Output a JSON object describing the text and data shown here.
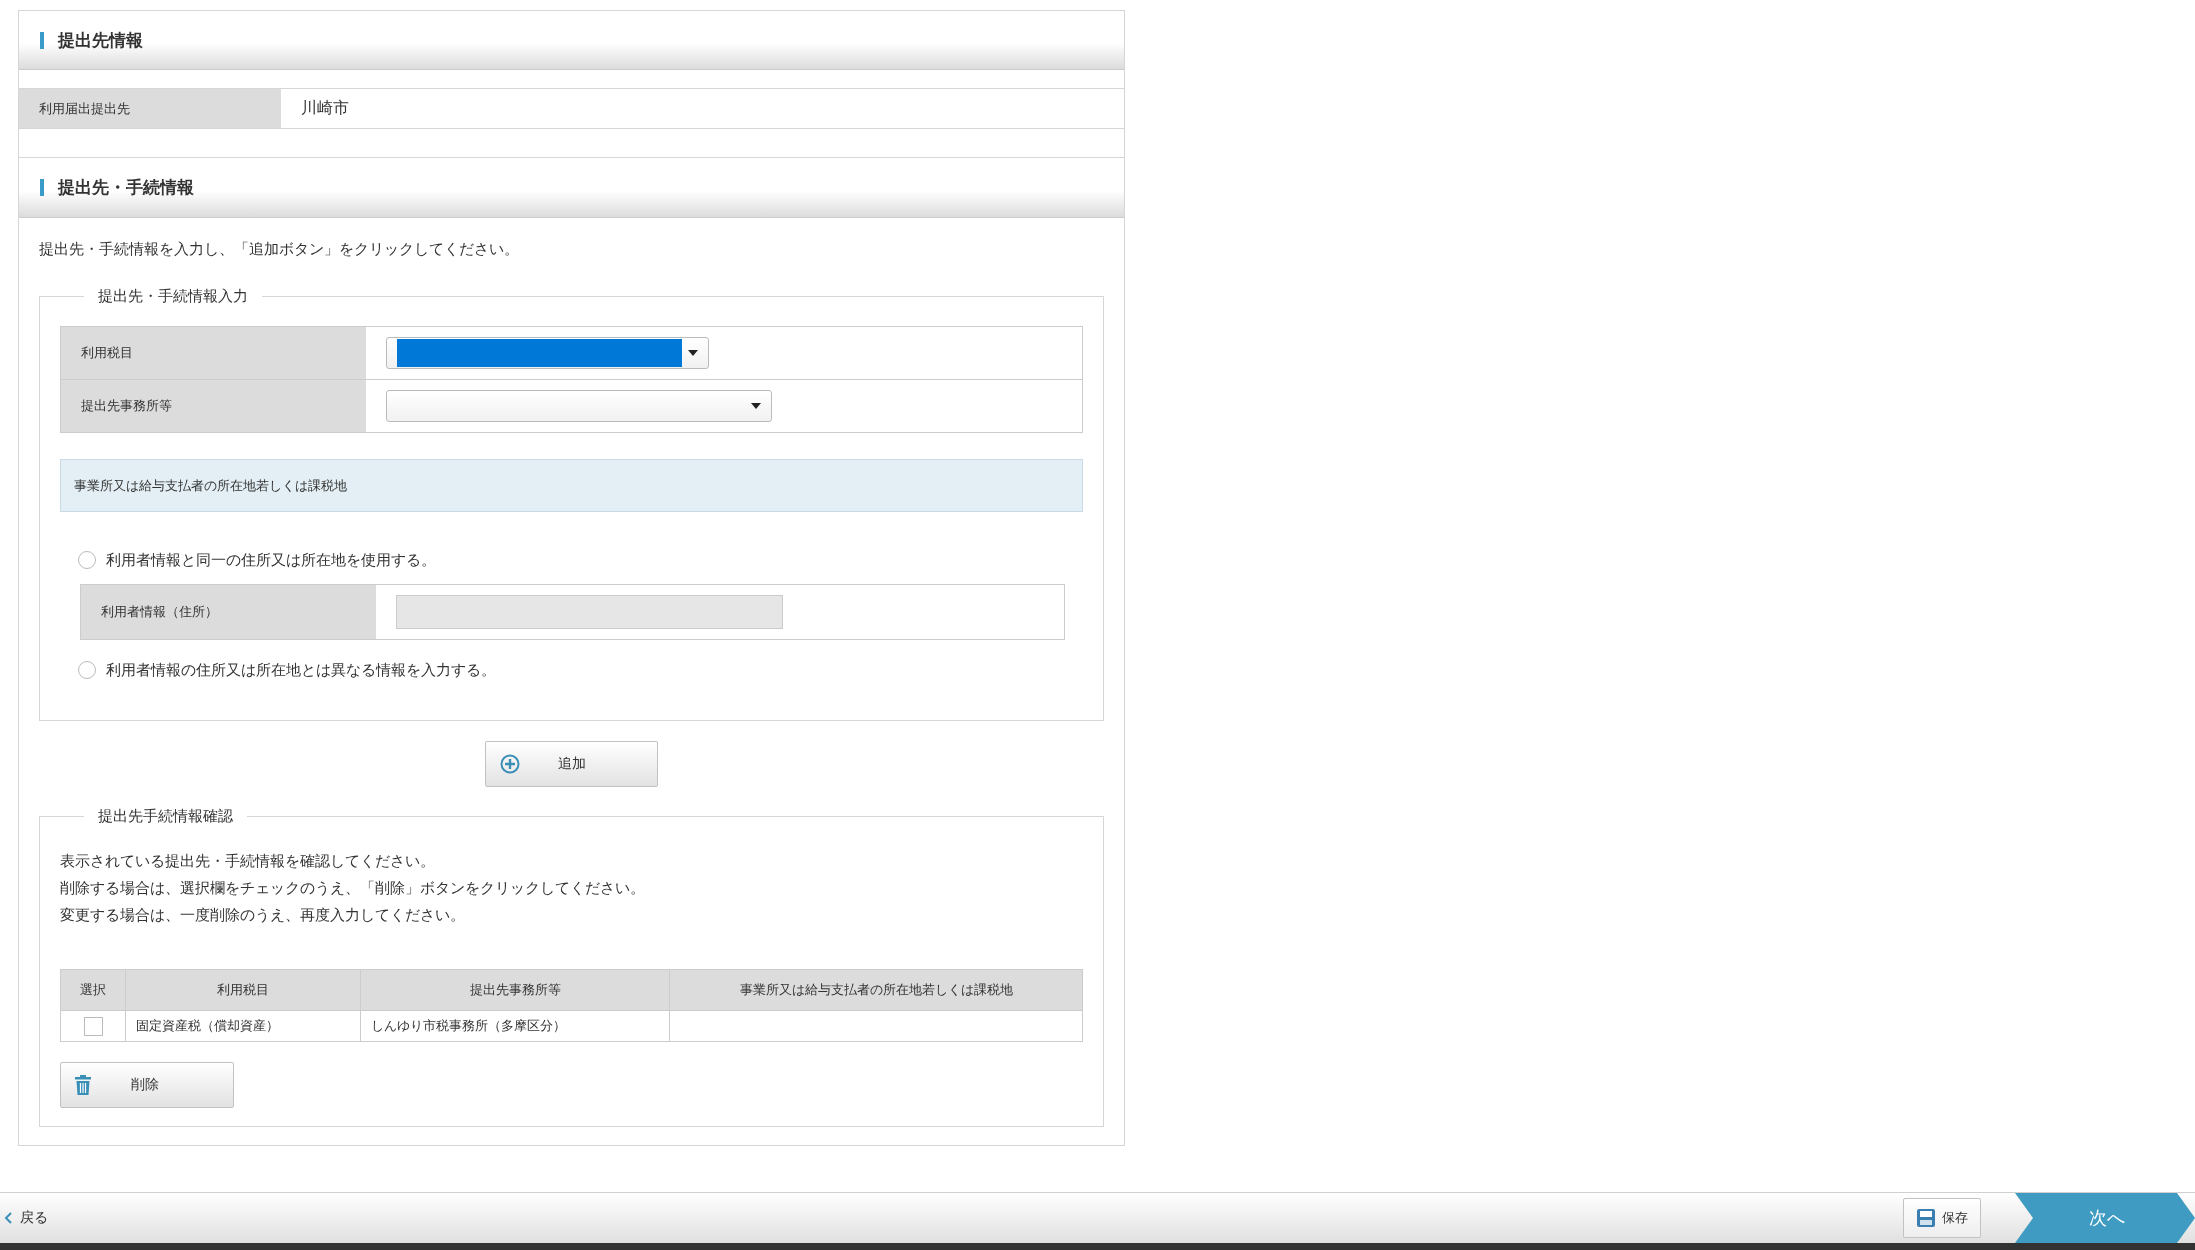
{
  "submission_info": {
    "title": "提出先情報",
    "rows": [
      {
        "label": "利用届出提出先",
        "value": "川崎市"
      }
    ]
  },
  "procedure_info": {
    "title": "提出先・手続情報",
    "instruction": "提出先・手続情報を入力し、「追加ボタン」をクリックしてください。",
    "input_group": {
      "legend": "提出先・手続情報入力",
      "fields": [
        {
          "label": "利用税目",
          "highlighted": true
        },
        {
          "label": "提出先事務所等",
          "highlighted": false
        }
      ],
      "location_heading": "事業所又は給与支払者の所在地若しくは課税地",
      "options": [
        {
          "label": "利用者情報と同一の住所又は所在地を使用する。",
          "selected": false
        },
        {
          "label": "利用者情報の住所又は所在地とは異なる情報を入力する。",
          "selected": false
        }
      ],
      "user_address": {
        "label": "利用者情報（住所）"
      }
    },
    "add_button": "追加",
    "confirm_group": {
      "legend": "提出先手続情報確認",
      "messages": [
        "表示されている提出先・手続情報を確認してください。",
        "削除する場合は、選択欄をチェックのうえ、「削除」ボタンをクリックしてください。",
        "変更する場合は、一度削除のうえ、再度入力してください。"
      ],
      "table": {
        "columns": [
          "選択",
          "利用税目",
          "提出先事務所等",
          "事業所又は給与支払者の所在地若しくは課税地"
        ],
        "rows": [
          {
            "checked": false,
            "cells": [
              "",
              "固定資産税（償却資産）",
              "しんゆり市税事務所（多摩区分）"
            ]
          }
        ]
      },
      "delete_button": "削除"
    }
  },
  "footer": {
    "back": "戻る",
    "save": "保存",
    "next": "次へ"
  }
}
